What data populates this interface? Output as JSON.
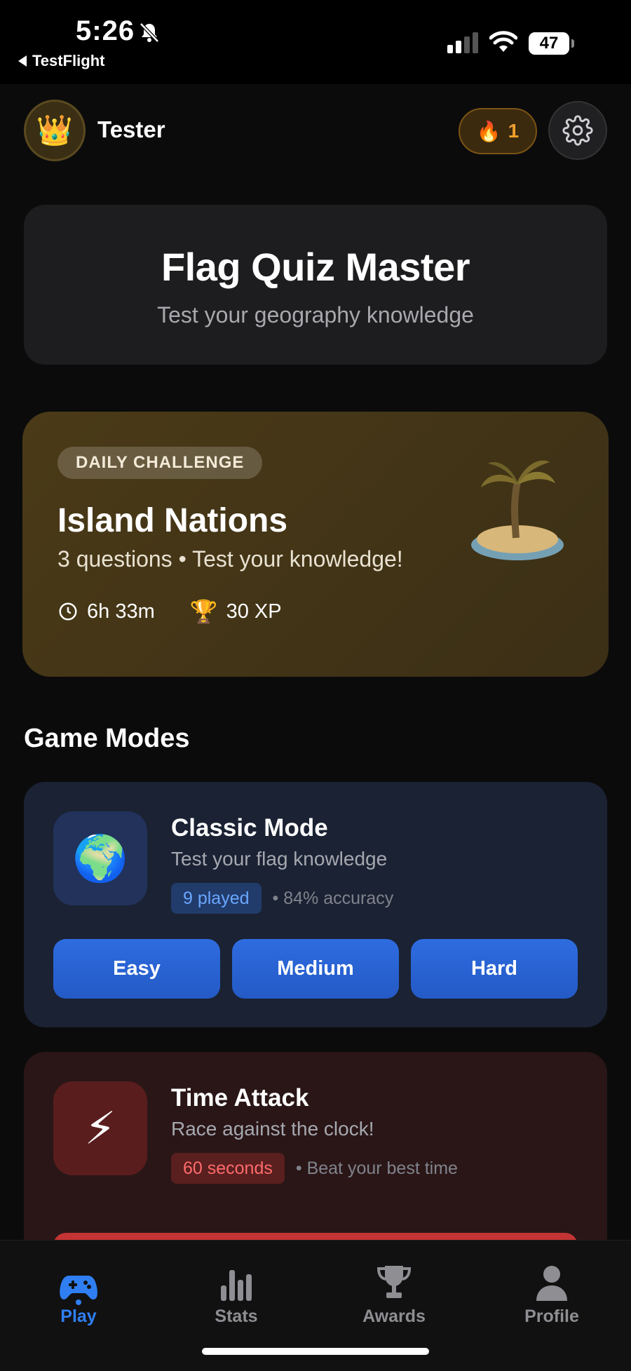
{
  "status_bar": {
    "time": "5:26",
    "back_app": "TestFlight",
    "battery": "47"
  },
  "header": {
    "avatar_emoji": "👑",
    "username": "Tester",
    "streak_emoji": "🔥",
    "streak_count": "1"
  },
  "hero": {
    "title": "Flag Quiz Master",
    "subtitle": "Test your geography knowledge"
  },
  "daily_challenge": {
    "badge": "DAILY CHALLENGE",
    "title": "Island Nations",
    "subtitle": "3 questions • Test your knowledge!",
    "time_left": "6h 33m",
    "reward_emoji": "🏆",
    "reward": "30 XP"
  },
  "game_modes": {
    "section_title": "Game Modes",
    "classic": {
      "icon": "🌍",
      "title": "Classic Mode",
      "subtitle": "Test your flag knowledge",
      "chip": "9 played",
      "extra": "• 84% accuracy",
      "buttons": [
        "Easy",
        "Medium",
        "Hard"
      ]
    },
    "attack": {
      "icon": "⚡",
      "title": "Time Attack",
      "subtitle": "Race against the clock!",
      "chip": "60 seconds",
      "extra": "• Beat your best time"
    }
  },
  "tabs": [
    {
      "label": "Play",
      "icon": "gamepad-icon",
      "active": true
    },
    {
      "label": "Stats",
      "icon": "bar-chart-icon",
      "active": false
    },
    {
      "label": "Awards",
      "icon": "trophy-icon",
      "active": false
    },
    {
      "label": "Profile",
      "icon": "person-icon",
      "active": false
    }
  ],
  "colors": {
    "accent_blue": "#2f7ff2",
    "streak_orange": "#f0a12b",
    "attack_red": "#c53434"
  }
}
